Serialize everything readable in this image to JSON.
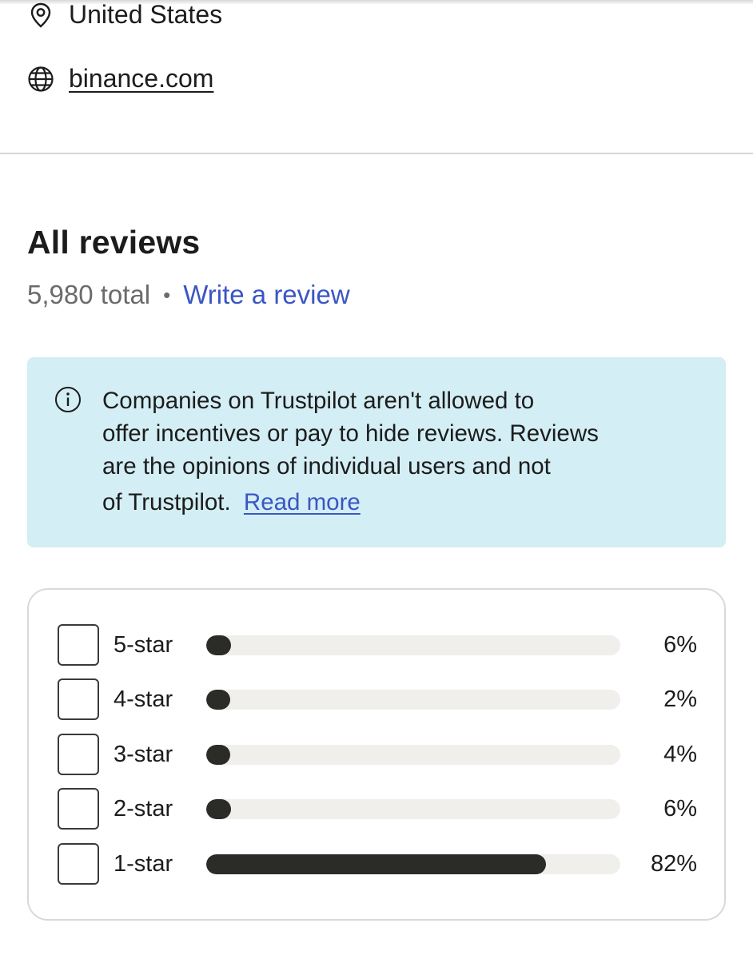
{
  "business_info": {
    "location": {
      "icon": "map-pin-icon",
      "text": "United States"
    },
    "website": {
      "icon": "globe-icon",
      "text": "binance.com"
    }
  },
  "reviews": {
    "title": "All reviews",
    "total": "5,980 total",
    "separator": "•",
    "write_review_label": "Write a review"
  },
  "notice": {
    "icon": "info-icon",
    "text": "Companies on Trustpilot aren't allowed to offer incentives or pay to hide reviews. Reviews are the opinions of individual users and not of Trustpilot.",
    "line1": "Companies on Trustpilot aren't allowed to",
    "line2": "offer incentives or pay to hide reviews. Reviews",
    "line3": "are the opinions of individual users and not",
    "line4": "of Trustpilot.",
    "read_more_label": "Read more",
    "background_color": "#d3eef4",
    "link_color": "#3a56c4"
  },
  "rating_distribution": [
    {
      "label": "5-star",
      "percent_label": "6%",
      "percent": 6
    },
    {
      "label": "4-star",
      "percent_label": "2%",
      "percent": 2
    },
    {
      "label": "3-star",
      "percent_label": "4%",
      "percent": 4
    },
    {
      "label": "2-star",
      "percent_label": "6%",
      "percent": 6
    },
    {
      "label": "1-star",
      "percent_label": "82%",
      "percent": 82
    }
  ],
  "colors": {
    "bar_fill": "#2b2b28",
    "bar_track": "#f1efec",
    "divider": "#d6d6d6"
  }
}
